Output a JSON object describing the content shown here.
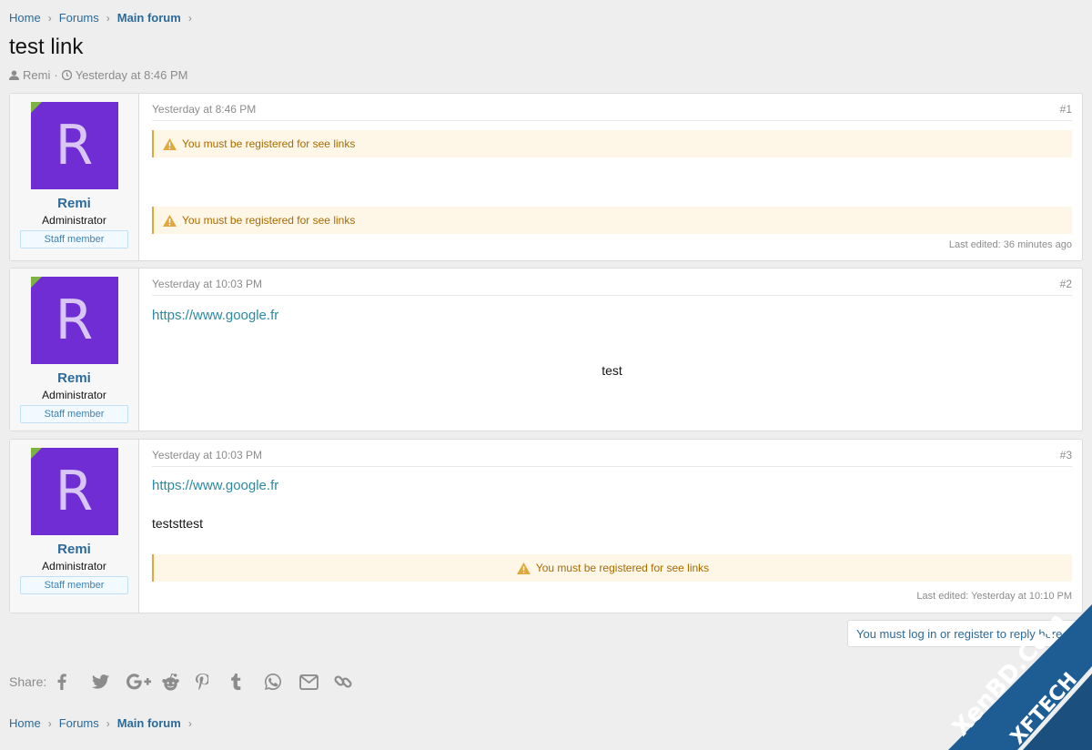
{
  "breadcrumb": {
    "home": "Home",
    "forums": "Forums",
    "current": "Main forum"
  },
  "thread": {
    "title": "test link",
    "author": "Remi",
    "separator": "·",
    "date": "Yesterday at 8:46 PM"
  },
  "posts": [
    {
      "user": {
        "initial": "R",
        "name": "Remi",
        "title": "Administrator",
        "badge": "Staff member"
      },
      "date": "Yesterday at 8:46 PM",
      "number": "#1",
      "notice1": "You must be registered for see links",
      "notice2": "You must be registered for see links",
      "edited": "Last edited: 36 minutes ago"
    },
    {
      "user": {
        "initial": "R",
        "name": "Remi",
        "title": "Administrator",
        "badge": "Staff member"
      },
      "date": "Yesterday at 10:03 PM",
      "number": "#2",
      "link": "https://www.google.fr",
      "text": "test"
    },
    {
      "user": {
        "initial": "R",
        "name": "Remi",
        "title": "Administrator",
        "badge": "Staff member"
      },
      "date": "Yesterday at 10:03 PM",
      "number": "#3",
      "link": "https://www.google.fr",
      "text": "teststtest",
      "notice": "You must be registered for see links",
      "edited": "Last edited: Yesterday at 10:10 PM"
    }
  ],
  "login_prompt": "You must log in or register to reply here.",
  "share": {
    "label": "Share:",
    "icons": [
      "facebook-icon",
      "twitter-icon",
      "google-plus-icon",
      "reddit-icon",
      "pinterest-icon",
      "tumblr-icon",
      "whatsapp-icon",
      "email-icon",
      "link-icon"
    ]
  },
  "watermark": {
    "line1": "XenBD.Com",
    "line2": "XFTECH"
  },
  "colors": {
    "accent": "#2b6a9a",
    "avatar": "#6f2dd3",
    "notice_bg": "#fef6e6",
    "notice_text": "#a86b00",
    "link": "#2b8aa0"
  }
}
